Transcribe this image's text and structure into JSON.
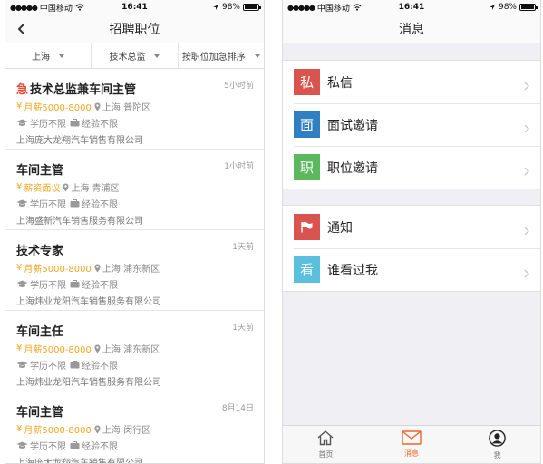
{
  "status_bar": {
    "carrier": "中国移动",
    "time": "16:41",
    "battery": "98%",
    "battery_level": 0.98
  },
  "left": {
    "nav_title": "招聘职位",
    "filters": [
      "上海",
      "技术总监",
      "按职位加急排序"
    ],
    "jobs": [
      {
        "urgent": "急",
        "title": "技术总监兼车间主管",
        "time": "5小时前",
        "salary": "月薪5000-8000",
        "location": "上海 普陀区",
        "education": "学历不限",
        "experience": "经验不限",
        "company": "上海庞大龙翔汽车销售有限公司"
      },
      {
        "urgent": "",
        "title": "车间主管",
        "time": "1小时前",
        "salary": "薪资面议",
        "location": "上海 青浦区",
        "education": "学历不限",
        "experience": "经验不限",
        "company": "上海盛新汽车销售服务有限公司"
      },
      {
        "urgent": "",
        "title": "技术专家",
        "time": "1天前",
        "salary": "月薪5000-8000",
        "location": "上海 浦东新区",
        "education": "学历不限",
        "experience": "经验不限",
        "company": "上海炜业龙阳汽车销售服务有限公司"
      },
      {
        "urgent": "",
        "title": "车间主任",
        "time": "1天前",
        "salary": "月薪5000-8000",
        "location": "上海 浦东新区",
        "education": "学历不限",
        "experience": "经验不限",
        "company": "上海炜业龙阳汽车销售服务有限公司"
      },
      {
        "urgent": "",
        "title": "车间主管",
        "time": "8月14日",
        "salary": "月薪5000-8000",
        "location": "上海 闵行区",
        "education": "学历不限",
        "experience": "经验不限",
        "company": "上海庞大龙翔汽车销售有限公司"
      }
    ]
  },
  "right": {
    "nav_title": "消息",
    "group1": [
      {
        "glyph": "私",
        "label": "私信",
        "color": "#d9534f",
        "icon": "private-message-icon"
      },
      {
        "glyph": "面",
        "label": "面试邀请",
        "color": "#2f7fc1",
        "icon": "interview-icon"
      },
      {
        "glyph": "职",
        "label": "职位邀请",
        "color": "#5cb85c",
        "icon": "job-invite-icon"
      }
    ],
    "group2": [
      {
        "glyph": "",
        "label": "通知",
        "color": "#d9534f",
        "icon": "flag-icon"
      },
      {
        "glyph": "看",
        "label": "谁看过我",
        "color": "#5bc0de",
        "icon": "viewers-icon"
      }
    ],
    "tabs": [
      {
        "label": "首页",
        "icon": "home-icon",
        "active": false
      },
      {
        "label": "消息",
        "icon": "mail-icon",
        "active": true
      },
      {
        "label": "我",
        "icon": "profile-icon",
        "active": false
      }
    ]
  }
}
